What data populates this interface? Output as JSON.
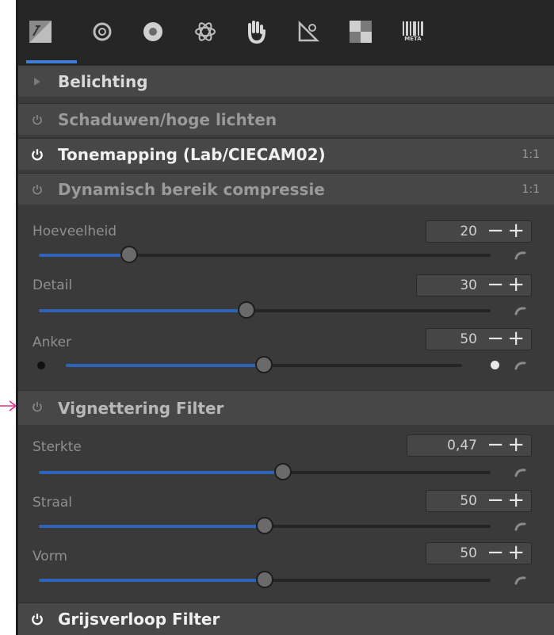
{
  "toolbar": {
    "tabs": [
      {
        "name": "exposure-tab-icon"
      },
      {
        "name": "detail-tab-icon"
      },
      {
        "name": "color-tab-icon"
      },
      {
        "name": "advanced-tab-icon"
      },
      {
        "name": "local-adjust-tab-icon"
      },
      {
        "name": "transform-tab-icon"
      },
      {
        "name": "raw-tab-icon"
      },
      {
        "name": "metadata-tab-icon",
        "label": "META"
      }
    ],
    "active_index": 0,
    "accent_color": "#3d7fd6"
  },
  "sections": {
    "belichting": {
      "label": "Belichting"
    },
    "schaduwen": {
      "label": "Schaduwen/hoge lichten"
    },
    "tonemapping": {
      "label": "Tonemapping (Lab/CIECAM02)",
      "badge": "1:1"
    },
    "dynamisch": {
      "label": "Dynamisch bereik compressie",
      "badge": "1:1"
    },
    "vignettering": {
      "label": "Vignettering Filter"
    },
    "grijsverloop": {
      "label": "Grijsverloop Filter"
    }
  },
  "dynamic_range": {
    "hoeveelheid": {
      "label": "Hoeveelheid",
      "value": "20",
      "fraction": 0.2
    },
    "detail": {
      "label": "Detail",
      "value": "30",
      "fraction": 0.46
    },
    "anker": {
      "label": "Anker",
      "value": "50",
      "fraction": 0.5
    }
  },
  "vignette": {
    "sterkte": {
      "label": "Sterkte",
      "value": "0,47",
      "fraction": 0.54
    },
    "straal": {
      "label": "Straal",
      "value": "50",
      "fraction": 0.5
    },
    "vorm": {
      "label": "Vorm",
      "value": "50",
      "fraction": 0.5
    }
  },
  "glyphs": {
    "minus": "−",
    "plus": "+",
    "arrow": "⟶",
    "meta": "META"
  },
  "colors": {
    "fill": "#2f63b8",
    "annotation_arrow": "#e0308a"
  }
}
